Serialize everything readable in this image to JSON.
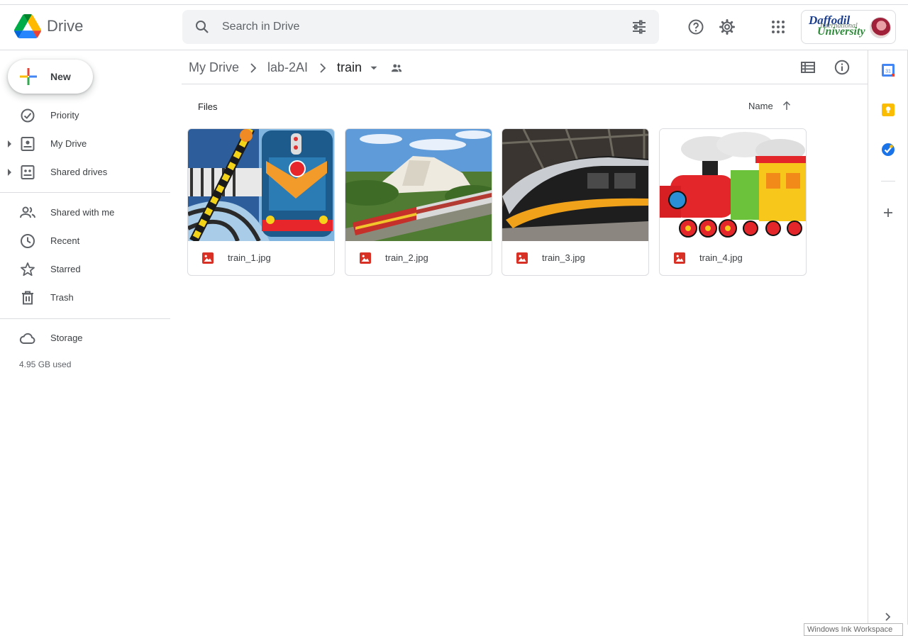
{
  "app": {
    "name": "Drive"
  },
  "search": {
    "placeholder": "Search in Drive"
  },
  "org": {
    "line1": "Daffodil",
    "line2": "University",
    "line3": "International"
  },
  "nav": {
    "new_label": "New",
    "items": [
      {
        "label": "Priority",
        "icon": "priority-icon"
      },
      {
        "label": "My Drive",
        "icon": "my-drive-icon"
      },
      {
        "label": "Shared drives",
        "icon": "shared-drives-icon"
      },
      {
        "label": "Shared with me",
        "icon": "shared-with-me-icon"
      },
      {
        "label": "Recent",
        "icon": "clock-icon"
      },
      {
        "label": "Starred",
        "icon": "star-icon"
      },
      {
        "label": "Trash",
        "icon": "trash-icon"
      },
      {
        "label": "Storage",
        "icon": "cloud-icon"
      }
    ],
    "storage_used": "4.95 GB used"
  },
  "breadcrumb": [
    "My Drive",
    "lab-2AI",
    "train"
  ],
  "main": {
    "section_label": "Files",
    "sort_label": "Name",
    "files": [
      {
        "name": "train_1.jpg"
      },
      {
        "name": "train_2.jpg"
      },
      {
        "name": "train_3.jpg"
      },
      {
        "name": "train_4.jpg"
      }
    ]
  },
  "side_panel": {
    "apps": [
      "calendar-icon",
      "keep-icon",
      "tasks-icon",
      "add-icon"
    ]
  },
  "overlay": {
    "ink_label": "Windows Ink Workspace"
  },
  "colors": {
    "accent": "#1a73e8",
    "file_icon": "#d93025",
    "border": "#dadce0"
  }
}
